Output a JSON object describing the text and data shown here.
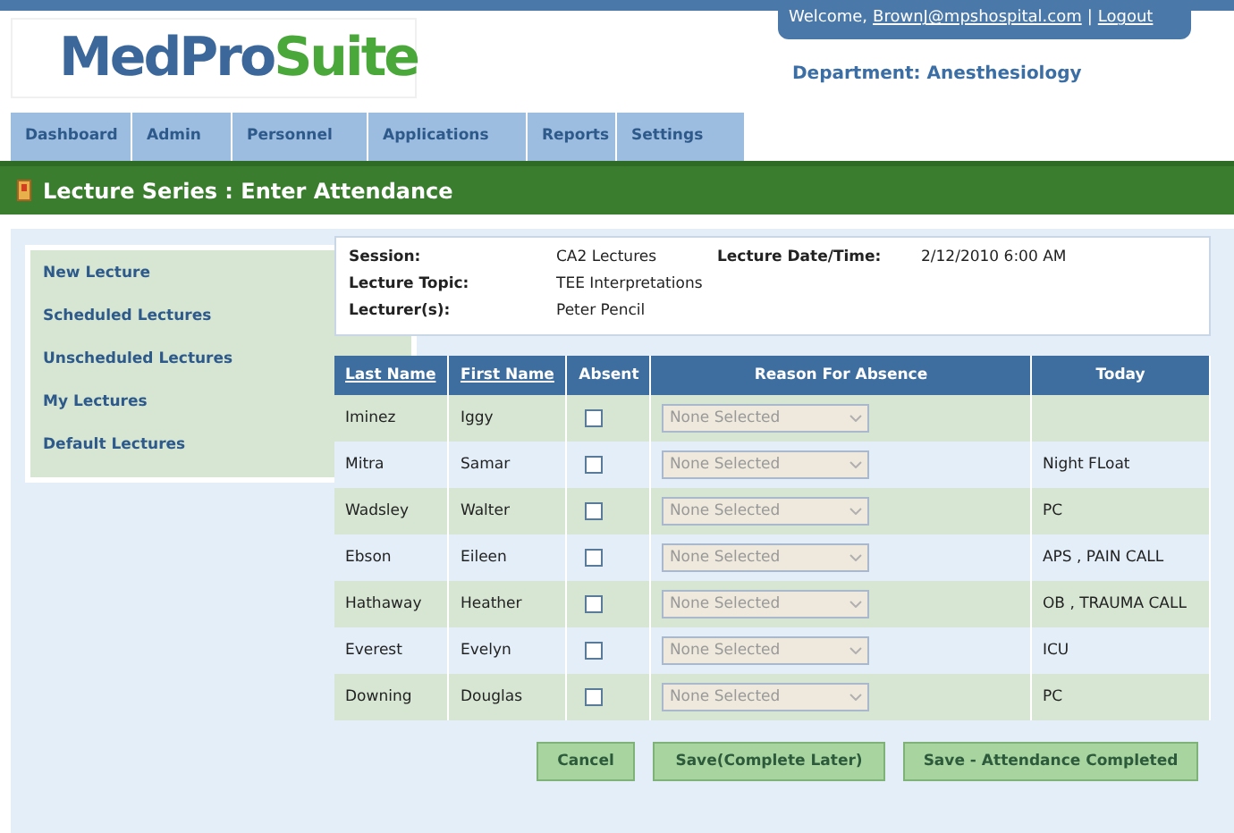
{
  "logo": {
    "first": "MedPro",
    "second": "Suite"
  },
  "user_bar": {
    "greeting": "Welcome,",
    "email": "BrownJ@mpshospital.com",
    "separator": "|",
    "logout": "Logout"
  },
  "department": "Department: Anesthesiology",
  "nav_tabs": [
    "Dashboard",
    "Admin",
    "Personnel",
    "Applications",
    "Reports",
    "Settings"
  ],
  "page_title": "Lecture Series : Enter Attendance",
  "sidebar": {
    "items": [
      "New Lecture",
      "Scheduled Lectures",
      "Unscheduled Lectures",
      "My Lectures",
      "Default Lectures"
    ]
  },
  "info": {
    "session_label": "Session:",
    "session": "CA2 Lectures",
    "date_label": "Lecture Date/Time:",
    "date": "2/12/2010 6:00 AM",
    "topic_label": "Lecture Topic:",
    "topic": "TEE Interpretations",
    "lecturer_label": "Lecturer(s):",
    "lecturer": "Peter Pencil"
  },
  "table": {
    "columns": [
      {
        "label": "Last Name",
        "sortable": true
      },
      {
        "label": "First Name",
        "sortable": true
      },
      {
        "label": "Absent",
        "sortable": false
      },
      {
        "label": "Reason For Absence",
        "sortable": false
      },
      {
        "label": "Today",
        "sortable": false
      }
    ],
    "rows": [
      {
        "last": "Iminez",
        "first": "Iggy",
        "absent": false,
        "reason": "None Selected"
      },
      {
        "last": "Mitra",
        "first": "Samar",
        "absent": false,
        "reason": "None Selected",
        "today": "Night FLoat"
      },
      {
        "last": "Wadsley",
        "first": "Walter",
        "absent": false,
        "reason": "None Selected",
        "today": "PC"
      },
      {
        "last": "Ebson",
        "first": "Eileen",
        "absent": false,
        "reason": "None Selected",
        "today": "APS , PAIN CALL"
      },
      {
        "last": "Hathaway",
        "first": "Heather",
        "absent": false,
        "reason": "None Selected",
        "today": "OB , TRAUMA CALL"
      },
      {
        "last": "Everest",
        "first": "Evelyn",
        "absent": false,
        "reason": "None Selected",
        "today": "ICU"
      },
      {
        "last": "Downing",
        "first": "Douglas",
        "absent": false,
        "reason": "None Selected",
        "today": "PC"
      }
    ]
  },
  "buttons": [
    "Cancel",
    "Save(Complete Later)",
    "Save - Attendance Completed"
  ]
}
